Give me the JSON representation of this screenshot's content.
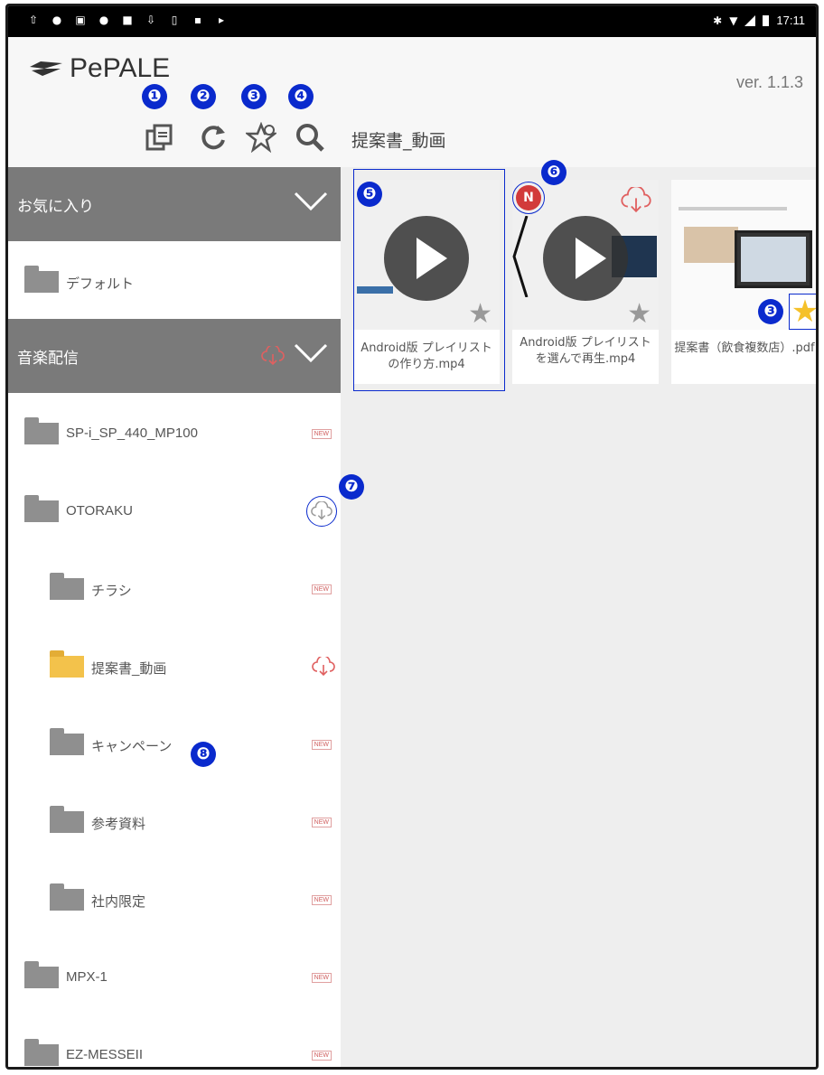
{
  "header": {
    "logo_text": "PePALE",
    "version": "ver. 1.1.3",
    "breadcrumb": "提案書_動画"
  },
  "toolbar": {
    "icons": [
      "file-sync-icon",
      "refresh-icon",
      "favorite-star-icon",
      "search-icon"
    ]
  },
  "badges": [
    "❶",
    "❷",
    "❸",
    "❹",
    "❺",
    "❻",
    "❸",
    "❼",
    "❽"
  ],
  "sidebar": {
    "favorites_label": "お気に入り",
    "favorite_item": "デフォルト",
    "delivery_label": "音楽配信",
    "items": [
      {
        "label": "SP-i_SP_440_MP100",
        "tag": "NEW"
      },
      {
        "label": "OTORAKU",
        "tag": "cloud"
      },
      {
        "label": "チラシ",
        "tag": "NEW"
      },
      {
        "label": "提案書_動画",
        "tag": "cloud"
      },
      {
        "label": "キャンペーン",
        "tag": "NEW"
      },
      {
        "label": "参考資料",
        "tag": "NEW"
      },
      {
        "label": "社内限定",
        "tag": "NEW"
      },
      {
        "label": "MPX-1",
        "tag": "NEW"
      },
      {
        "label": "EZ-MESSEII",
        "tag": "NEW"
      }
    ]
  },
  "cards": [
    {
      "caption": "Android版 プレイリストの作り方.mp4"
    },
    {
      "caption": "Android版 プレイリストを選んで再生.mp4",
      "badge": "N"
    },
    {
      "caption": "提案書（飲食複数店）.pdf"
    }
  ],
  "colors": {
    "accent_blue": "#0a2acd",
    "section_grey": "#7a7a7a",
    "new_badge_red": "#d23a3a",
    "star_yellow": "#f5c12a"
  }
}
